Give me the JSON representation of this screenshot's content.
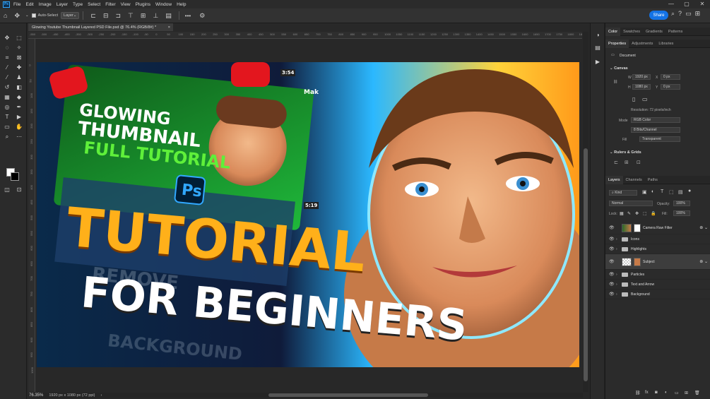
{
  "menubar": {
    "app_icon": "Ps",
    "items": [
      "File",
      "Edit",
      "Image",
      "Layer",
      "Type",
      "Select",
      "Filter",
      "View",
      "Plugins",
      "Window",
      "Help"
    ],
    "window_controls": [
      "—",
      "▢",
      "✕"
    ]
  },
  "options": {
    "auto_select_label": "Auto-Select",
    "auto_select_target": "Layer",
    "more_label": "•••",
    "share_label": "Share"
  },
  "document": {
    "tab_title": "Glowing Youtube Thumbnail Layered PSD File.psd @ 76.4% (RGB/8#) *",
    "tab_close": "×",
    "ruler_ticks_h": [
      "-550",
      "-500",
      "-450",
      "-400",
      "-350",
      "-300",
      "-250",
      "-200",
      "-150",
      "-100",
      "-50",
      "0",
      "50",
      "100",
      "150",
      "200",
      "250",
      "300",
      "350",
      "400",
      "450",
      "500",
      "550",
      "600",
      "650",
      "700",
      "750",
      "800",
      "850",
      "900",
      "950",
      "1000",
      "1050",
      "1100",
      "1150",
      "1200",
      "1250",
      "1300",
      "1350",
      "1400",
      "1450",
      "1500",
      "1550",
      "1600",
      "1650",
      "1700",
      "1750",
      "1800",
      "1850",
      "1900"
    ],
    "ruler_ticks_v": [
      "0",
      "50",
      "100",
      "150",
      "200",
      "250",
      "300",
      "350",
      "400",
      "450",
      "500",
      "550",
      "600",
      "650",
      "700",
      "750",
      "800",
      "850",
      "900",
      "950",
      "1000"
    ]
  },
  "canvas_art": {
    "headline_1": "GLOWING",
    "headline_2": "THUMBNAIL",
    "headline_3": "FULL TUTORIAL",
    "big_1": "TUTORIAL",
    "big_2": "FOR BEGINNERS",
    "ps_badge": "Ps",
    "duration_1": "5:19",
    "duration_2": "3:54",
    "side_word": "Mak",
    "ghost_text_1": "REMOVE",
    "ghost_text_2": "BACKGROUND"
  },
  "status": {
    "zoom": "76.35%",
    "doc_size": "1920 px x 1080 px (72 ppi)",
    "arrow": "›"
  },
  "panel_top": {
    "tabs": [
      "Color",
      "Swatches",
      "Gradients",
      "Patterns"
    ],
    "active": "Color"
  },
  "properties": {
    "tabs": [
      "Properties",
      "Adjustments",
      "Libraries"
    ],
    "doc_label": "Document",
    "canvas_header": "Canvas",
    "w_label": "W",
    "w_value": "1920 px",
    "h_label": "H",
    "h_value": "1080 px",
    "x_label": "X",
    "x_value": "0 px",
    "y_label": "Y",
    "y_value": "0 px",
    "resolution": "Resolution: 72 pixels/inch",
    "mode_label": "Mode",
    "mode_value": "RGB Color",
    "depth_value": "8 Bits/Channel",
    "fill_label": "Fill",
    "fill_value": "Transparent",
    "rulers_header": "Rulers & Grids"
  },
  "layers_panel": {
    "tabs": [
      "Layers",
      "Channels",
      "Paths"
    ],
    "kind_label": "Kind",
    "blend_mode": "Normal",
    "opacity_label": "Opacity:",
    "opacity_value": "100%",
    "lock_label": "Lock:",
    "fill_label": "Fill:",
    "fill_value": "100%",
    "layers": [
      {
        "name": "Camera Raw Filter",
        "type": "smart"
      },
      {
        "name": "Icons",
        "type": "group"
      },
      {
        "name": "Highlights",
        "type": "group"
      },
      {
        "name": "Subject",
        "type": "smart"
      },
      {
        "name": "Particles",
        "type": "group"
      },
      {
        "name": "Text and Arrow",
        "type": "group"
      },
      {
        "name": "Background",
        "type": "group"
      }
    ],
    "footer_icons": [
      "link-icon",
      "fx-icon",
      "mask-icon",
      "adjustment-icon",
      "group-icon",
      "new-layer-icon",
      "trash-icon"
    ],
    "footer_glyphs": [
      "⛓",
      "fx",
      "◙",
      "◐",
      "▭",
      "⊞",
      "🗑"
    ]
  },
  "colors": {
    "accent": "#1473e6",
    "panel_bg": "#2b2b2b",
    "canvas_bg": "#282828"
  }
}
